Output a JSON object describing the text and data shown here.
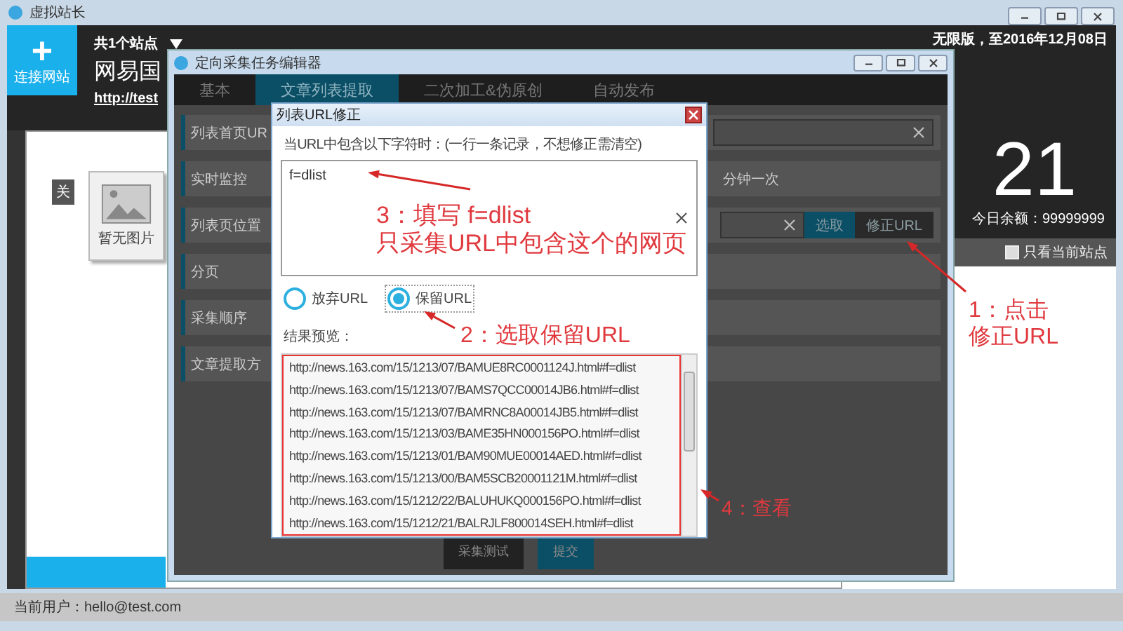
{
  "app_window": {
    "title": "虚拟站长",
    "connect_button": "连接网站",
    "connect_icon": "+",
    "site_count": "共1个站点",
    "site_name": "网易国",
    "site_url": "http://test",
    "license": "无限版，至2016年12月08日",
    "big_number": "21",
    "balance": "今日余额：99999999",
    "only_current_site": {
      "label": "只看当前站点",
      "checked": false
    },
    "card": {
      "badge": "关",
      "image_label": "暂无图片"
    },
    "status_bar": "当前用户：hello@test.com"
  },
  "editor": {
    "title": "定向采集任务编辑器",
    "tabs": [
      {
        "label": "基本",
        "selected": false
      },
      {
        "label": "文章列表提取",
        "selected": true
      },
      {
        "label": "二次加工&伪原创",
        "selected": false
      },
      {
        "label": "自动发布",
        "selected": false
      }
    ],
    "rows": [
      {
        "label": "列表首页UR",
        "kind": "field"
      },
      {
        "label": "实时监控",
        "kind": "text",
        "text": "分钟一次"
      },
      {
        "label": "列表页位置",
        "kind": "picker",
        "buttons": [
          "选取",
          "修正URL"
        ]
      },
      {
        "label": "分页",
        "kind": "empty"
      },
      {
        "label": "采集顺序",
        "kind": "empty"
      },
      {
        "label": "文章提取方",
        "kind": "empty"
      }
    ],
    "footer_buttons": [
      "采集测试",
      "提交"
    ]
  },
  "dialog": {
    "title": "列表URL修正",
    "instruction": "当URL中包含以下字符时：(一行一条记录，不想修正需清空)",
    "textarea": {
      "value": "f=dlist"
    },
    "options": [
      {
        "label": "放弃URL",
        "selected": false
      },
      {
        "label": "保留URL",
        "selected": true
      }
    ],
    "preview_label": "结果预览：",
    "preview_urls": [
      "http://news.163.com/15/1213/07/BAMUE8RC0001124J.html#f=dlist",
      "http://news.163.com/15/1213/07/BAMS7QCC00014JB6.html#f=dlist",
      "http://news.163.com/15/1213/07/BAMRNC8A00014JB5.html#f=dlist",
      "http://news.163.com/15/1213/03/BAME35HN000156PO.html#f=dlist",
      "http://news.163.com/15/1213/01/BAM90MUE00014AED.html#f=dlist",
      "http://news.163.com/15/1213/00/BAM5SCB20001121M.html#f=dlist",
      "http://news.163.com/15/1212/22/BALUHUKQ000156PO.html#f=dlist",
      "http://news.163.com/15/1212/21/BALRJLF800014SEH.html#f=dlist"
    ]
  },
  "annotations": [
    {
      "lines": [
        "3：填写 f=dlist",
        "只采集URL中包含这个的网页"
      ]
    },
    {
      "lines": [
        "2：选取保留URL"
      ]
    },
    {
      "lines": [
        "1：点击",
        "修正URL"
      ]
    },
    {
      "lines": [
        "4：查看"
      ]
    }
  ]
}
